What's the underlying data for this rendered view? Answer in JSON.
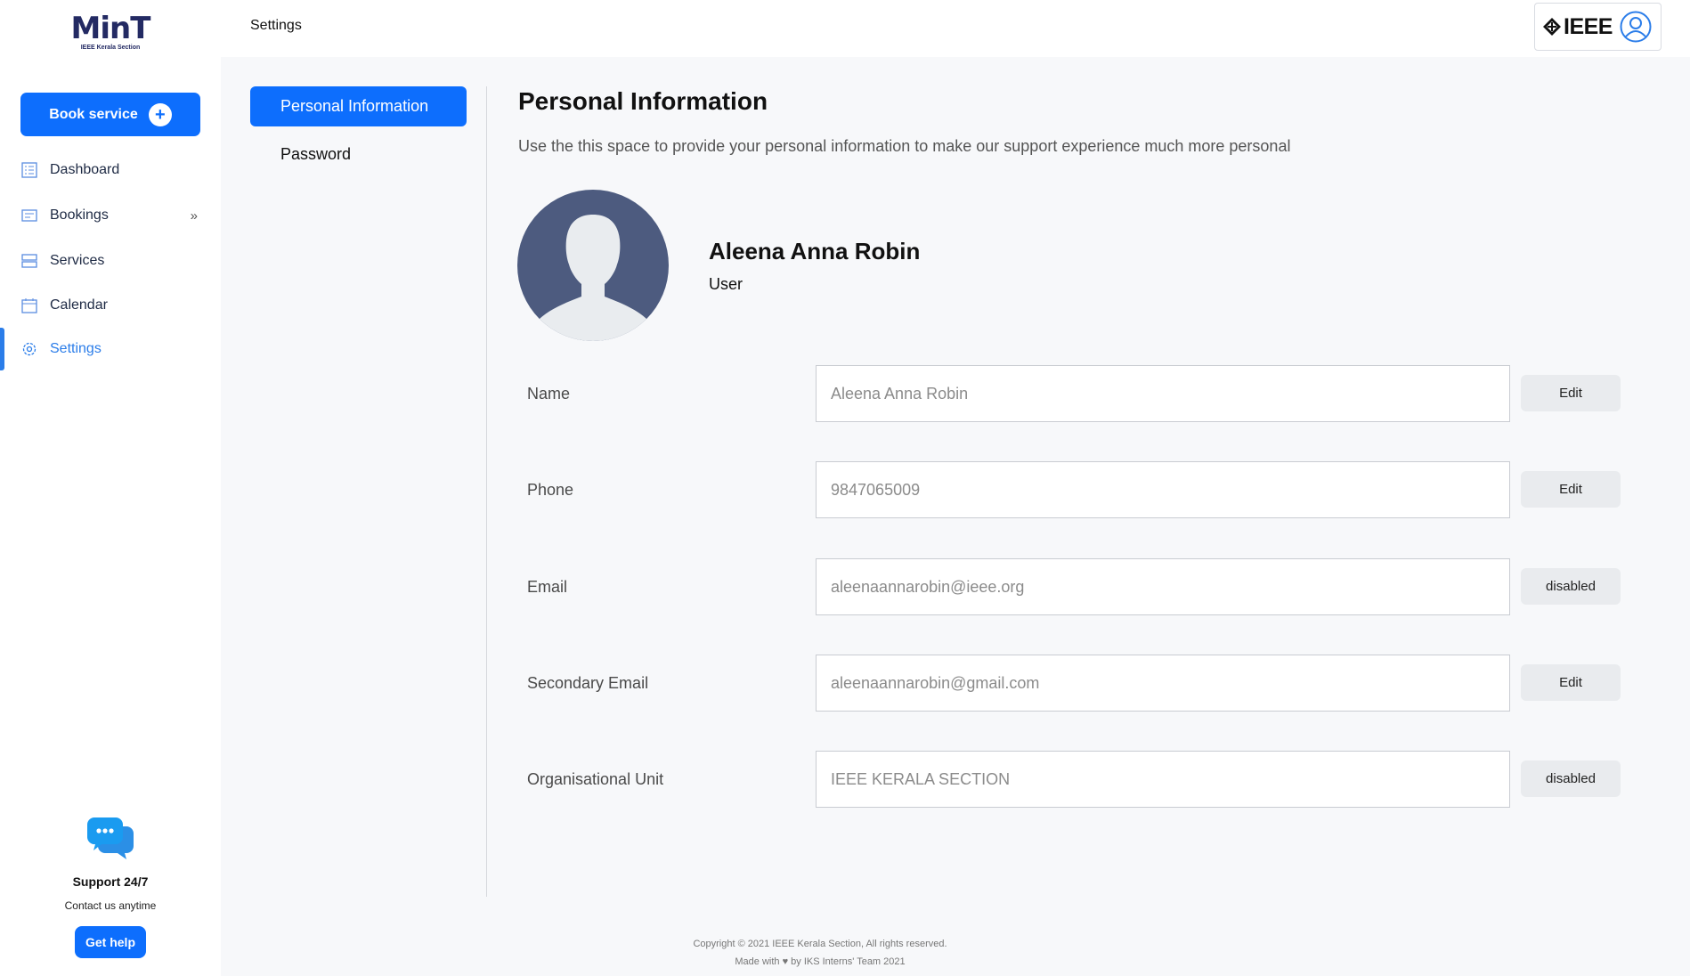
{
  "logo": {
    "text_main": "MinT",
    "text_sub": "IEEE Kerala Section"
  },
  "sidebar": {
    "book_label": "Book service",
    "items": [
      {
        "label": "Dashboard",
        "icon": "dashboard-icon"
      },
      {
        "label": "Bookings",
        "icon": "bookings-icon"
      },
      {
        "label": "Services",
        "icon": "services-icon"
      },
      {
        "label": "Calendar",
        "icon": "calendar-icon"
      },
      {
        "label": "Settings",
        "icon": "settings-icon",
        "active": true
      }
    ],
    "chevron": "»",
    "support": {
      "title": "Support 24/7",
      "subtitle": "Contact us anytime",
      "button": "Get help"
    }
  },
  "header": {
    "breadcrumb": "Settings",
    "brand": "IEEE"
  },
  "settings": {
    "tabs": [
      {
        "label": "Personal Information",
        "active": true
      },
      {
        "label": "Password"
      }
    ],
    "title": "Personal Information",
    "description": "Use the this space to provide your personal information to make our support experience much more personal",
    "profile": {
      "name": "Aleena Anna Robin",
      "role": "User"
    },
    "fields": [
      {
        "label": "Name",
        "value": "Aleena Anna Robin",
        "action": "Edit"
      },
      {
        "label": "Phone",
        "value": "9847065009",
        "action": "Edit"
      },
      {
        "label": "Email",
        "value": "aleenaannarobin@ieee.org",
        "action": "disabled"
      },
      {
        "label": "Secondary Email",
        "value": "aleenaannarobin@gmail.com",
        "action": "Edit"
      },
      {
        "label": "Organisational Unit",
        "value": "IEEE KERALA SECTION",
        "action": "disabled"
      }
    ]
  },
  "footer": {
    "line1": "Copyright © 2021 IEEE Kerala Section, All rights reserved.",
    "line2": "Made with ♥ by IKS Interns' Team 2021"
  },
  "colors": {
    "accent": "#0d6efd",
    "avatar_bg": "#4d5b7f",
    "nav_active": "#2b7de9"
  }
}
